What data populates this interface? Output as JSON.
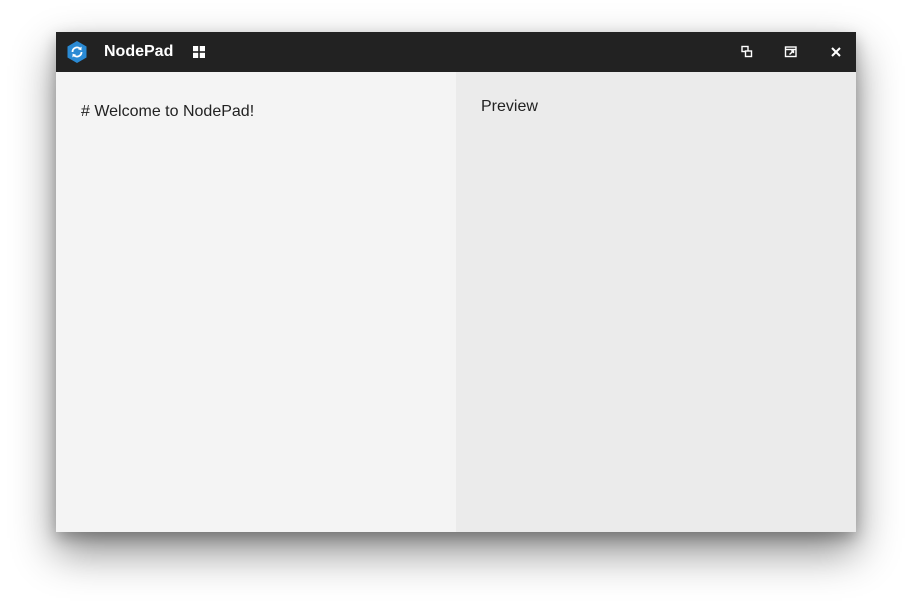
{
  "app": {
    "title": "NodePad",
    "logo_icon": "hexagon-sync-logo",
    "accent_color": "#2a8ad4"
  },
  "titlebar": {
    "background": "#222222",
    "layout_icon": "grid-icon",
    "controls": [
      {
        "name": "restore-window-button",
        "icon": "restore-icon"
      },
      {
        "name": "popout-window-button",
        "icon": "popout-icon"
      },
      {
        "name": "close-window-button",
        "icon": "close-icon"
      }
    ]
  },
  "editor": {
    "content": "# Welcome to NodePad!",
    "background": "#f4f4f4"
  },
  "preview": {
    "label": "Preview",
    "background": "#ebebeb"
  }
}
